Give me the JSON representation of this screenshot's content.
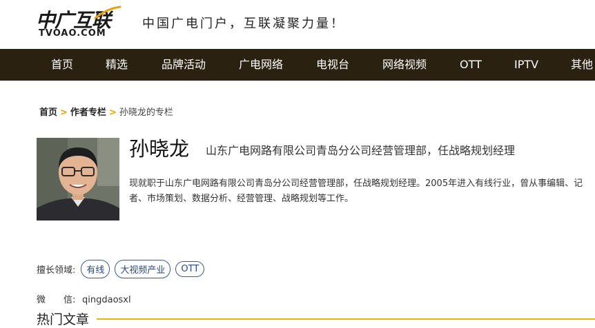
{
  "header": {
    "logo_main": "中广互联",
    "logo_sub": "TVOAO.COM",
    "slogan": "中国广电门户，互联凝聚力量！"
  },
  "nav": {
    "items": [
      {
        "label": "首页"
      },
      {
        "label": "精选"
      },
      {
        "label": "品牌活动"
      },
      {
        "label": "广电网络"
      },
      {
        "label": "电视台"
      },
      {
        "label": "网络视频"
      },
      {
        "label": "OTT"
      },
      {
        "label": "IPTV"
      },
      {
        "label": "其他"
      }
    ],
    "background": "#2b2111"
  },
  "breadcrumb": {
    "home": "首页",
    "column": "作者专栏",
    "current": "孙晓龙的专栏",
    "separator": ">"
  },
  "author": {
    "name": "孙晓龙",
    "title": "山东广电网路有限公司青岛分公司经营管理部，任战略规划经理",
    "bio": "现就职于山东广电网路有限公司青岛分公司经营管理部，任战略规划经理。2005年进入有线行业，曾从事编辑、记者、市场策划、数据分析、经营管理、战略规划等工作。",
    "expertise_label": "擅长领域:",
    "tags": [
      "有线",
      "大视频产业",
      "OTT"
    ],
    "wechat_label": "微　　信:",
    "wechat_id": "qingdaosxl"
  },
  "sections": {
    "popular_title": "热门文章"
  },
  "colors": {
    "accent": "#e8b400",
    "tag_border": "#3a5a8a"
  }
}
